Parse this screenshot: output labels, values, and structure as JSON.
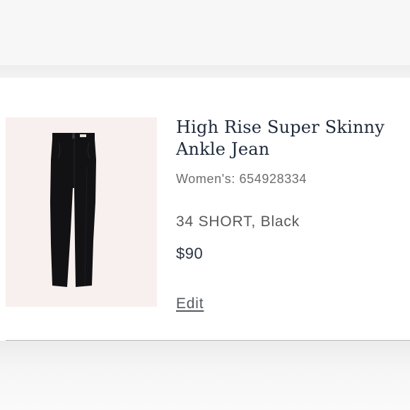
{
  "product": {
    "title": "High Rise Super Skinny Ankle Jean",
    "style_number": "Women's: 654928334",
    "variant": "34 SHORT, Black",
    "price": "$90",
    "image_icon": "jeans-image",
    "edit_label": "Edit"
  },
  "colors": {
    "title": "#1f2a3c",
    "thumb_background": "#f8f0ee",
    "jean": "#121214"
  }
}
